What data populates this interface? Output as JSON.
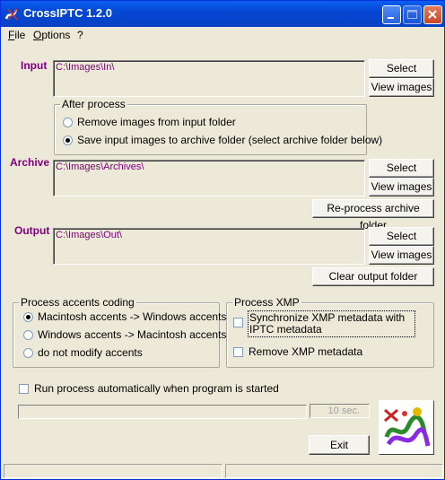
{
  "window": {
    "title": "CrossIPTC 1.2.0"
  },
  "menu": [
    "File",
    "Options",
    "?"
  ],
  "input": {
    "label": "Input",
    "path": "C:\\Images\\In\\",
    "select": "Select",
    "view": "View images"
  },
  "after_process": {
    "title": "After process",
    "options": [
      {
        "label": "Remove images from input folder",
        "selected": false
      },
      {
        "label": "Save input images to archive folder (select archive folder below)",
        "selected": true
      }
    ]
  },
  "archive": {
    "label": "Archive",
    "path": "C:\\Images\\Archives\\",
    "select": "Select",
    "view": "View images",
    "reprocess": "Re-process archive folder"
  },
  "output": {
    "label": "Output",
    "path": "C:\\Images\\Out\\",
    "select": "Select",
    "view": "View images",
    "clear": "Clear output folder"
  },
  "accents": {
    "title": "Process accents coding",
    "options": [
      {
        "label": "Macintosh accents -> Windows accents",
        "selected": true
      },
      {
        "label": "Windows accents -> Macintosh accents",
        "selected": false
      },
      {
        "label": "do not modify accents",
        "selected": false
      }
    ]
  },
  "xmp": {
    "title": "Process XMP",
    "sync": {
      "label": "Synchronize XMP metadata with IPTC metadata",
      "checked": false
    },
    "remove": {
      "label": "Remove XMP metadata",
      "checked": false
    }
  },
  "auto_run": {
    "label": "Run process automatically when program is started",
    "checked": false
  },
  "progress": {
    "value": 0,
    "timer": "10 sec."
  },
  "exit": "Exit",
  "colors": {
    "title_bar": "#0a5fef",
    "path_text": "#800080",
    "label_text": "#800080"
  }
}
